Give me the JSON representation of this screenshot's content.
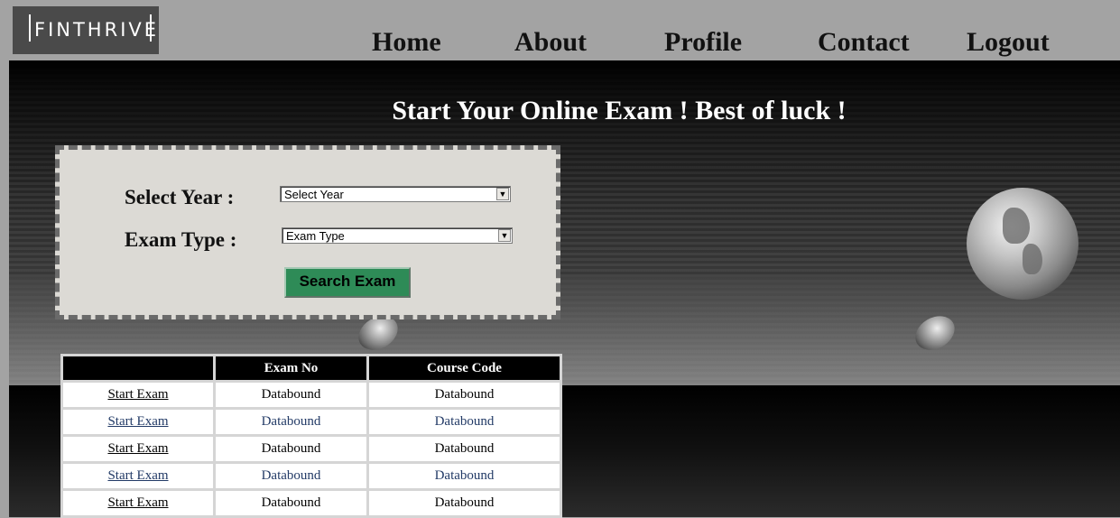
{
  "logo": {
    "text": "FINTHRIVE"
  },
  "nav": {
    "items": [
      "Home",
      "About",
      "Profile",
      "Contact",
      "Logout"
    ]
  },
  "banner": {
    "headline": "Start Your Online Exam ! Best of luck !"
  },
  "search_form": {
    "year_label": "Select Year :",
    "year_value": "Select Year",
    "exam_type_label": "Exam Type :",
    "exam_type_value": "Exam Type",
    "search_button": "Search Exam",
    "button_color": "#2e8b57"
  },
  "exam_table": {
    "columns": [
      "",
      "Exam No",
      "Course Code"
    ],
    "rows": [
      {
        "action": "Start Exam",
        "exam_no": "Databound",
        "course_code": "Databound"
      },
      {
        "action": "Start Exam",
        "exam_no": "Databound",
        "course_code": "Databound"
      },
      {
        "action": "Start Exam",
        "exam_no": "Databound",
        "course_code": "Databound"
      },
      {
        "action": "Start Exam",
        "exam_no": "Databound",
        "course_code": "Databound"
      },
      {
        "action": "Start Exam",
        "exam_no": "Databound",
        "course_code": "Databound"
      }
    ]
  }
}
